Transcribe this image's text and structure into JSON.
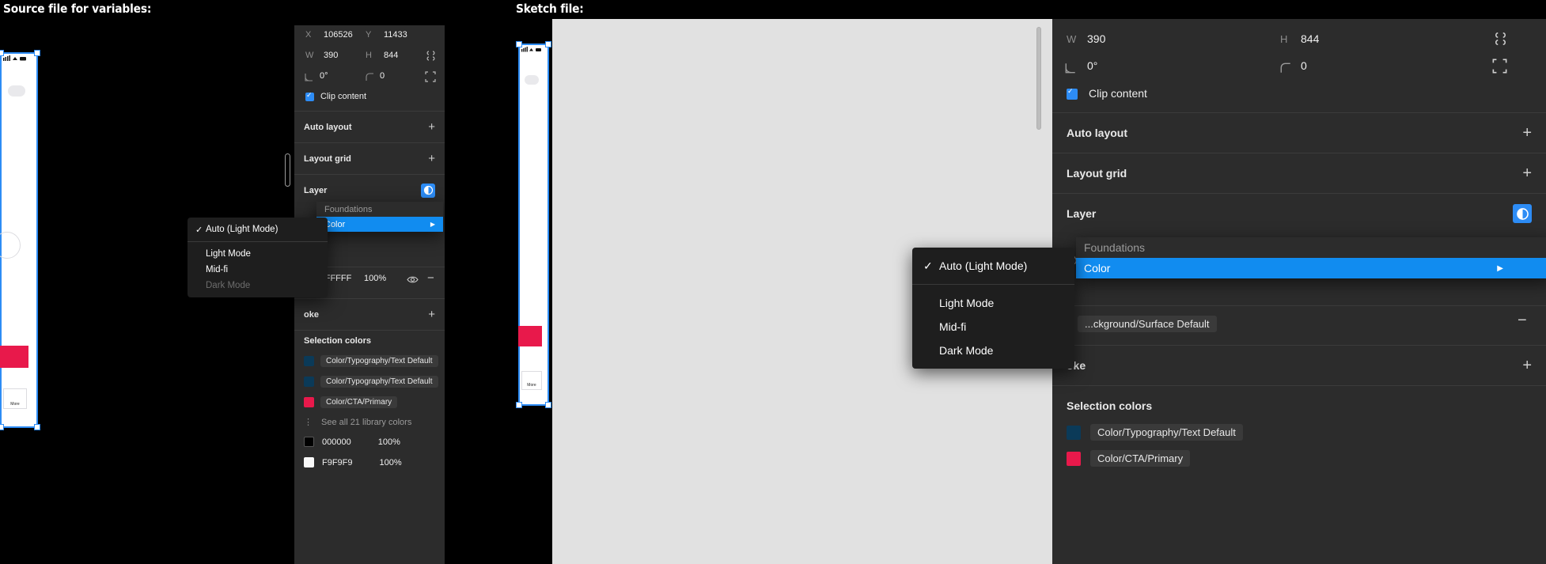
{
  "captions": {
    "left": "Source file for variables:",
    "right": "Sketch file:"
  },
  "left_panel": {
    "geometry": {
      "x_label": "X",
      "x_value": "106526",
      "y_label": "Y",
      "y_value": "11433",
      "w_label": "W",
      "w_value": "390",
      "h_label": "H",
      "h_value": "844",
      "rotation_label": "rotation-icon",
      "rotation_value": "0°",
      "corner_label": "corner-radius-icon",
      "corner_value": "0",
      "clip_content_label": "Clip content",
      "clip_content_checked": true,
      "constrain_icon": "constrain-proportions-icon",
      "independent_corners_icon": "independent-corners-icon"
    },
    "sections": [
      {
        "title": "Auto layout",
        "action": "+"
      },
      {
        "title": "Layout grid",
        "action": "+"
      }
    ],
    "layer_section": {
      "title": "Layer",
      "mode_icon": "variable-mode-icon"
    },
    "fill": {
      "hex": "FFFFFF",
      "opacity": "100%",
      "visibility_icon": "eye-icon",
      "remove_icon": "minus-icon"
    },
    "stroke": {
      "title": "oke",
      "action": "+"
    },
    "selection_colors": {
      "title": "Selection colors",
      "items": [
        {
          "swatch": "#0b3a58",
          "label": "Color/Typography/Text Default"
        },
        {
          "swatch": "#0b3a58",
          "label": "Color/Typography/Text Default"
        },
        {
          "swatch": "#e8194b",
          "label": "Color/CTA/Primary"
        }
      ],
      "see_all": "See all 21 library colors",
      "raw": [
        {
          "swatch": "#000000",
          "hex": "000000",
          "opacity": "100%"
        },
        {
          "swatch": "#f9f9f9",
          "hex": "F9F9F9",
          "opacity": "100%"
        }
      ]
    },
    "context_menu": {
      "items": [
        {
          "label": "Auto (Light Mode)",
          "checked": true,
          "disabled": false
        },
        {
          "label": "Light Mode",
          "checked": false,
          "disabled": false
        },
        {
          "label": "Mid-fi",
          "checked": false,
          "disabled": false
        },
        {
          "label": "Dark Mode",
          "checked": false,
          "disabled": true
        }
      ]
    },
    "submenu": {
      "items": [
        {
          "label": "Foundations",
          "selected": false,
          "arrow": ""
        },
        {
          "label": "Color",
          "selected": true,
          "arrow": "▶"
        }
      ]
    }
  },
  "right_panel": {
    "geometry": {
      "w_label": "W",
      "w_value": "390",
      "h_label": "H",
      "h_value": "844",
      "rotation_value": "0°",
      "corner_value": "0",
      "clip_content_label": "Clip content",
      "clip_content_checked": true
    },
    "sections": [
      {
        "title": "Auto layout",
        "action": "+"
      },
      {
        "title": "Layout grid",
        "action": "+"
      }
    ],
    "layer_section": {
      "title": "Layer",
      "mode_icon": "variable-mode-icon"
    },
    "fill": {
      "label": "...ckground/Surface Default",
      "remove_icon": "minus-icon"
    },
    "stroke": {
      "title": "oke",
      "action": "+"
    },
    "selection_colors": {
      "title": "Selection colors",
      "items": [
        {
          "swatch": "#0b3a58",
          "label": "Color/Typography/Text Default"
        },
        {
          "swatch": "#e8194b",
          "label": "Color/CTA/Primary"
        }
      ]
    },
    "context_menu": {
      "items": [
        {
          "label": "Auto (Light Mode)",
          "checked": true,
          "disabled": false
        },
        {
          "label": "Light Mode",
          "checked": false,
          "disabled": false
        },
        {
          "label": "Mid-fi",
          "checked": false,
          "disabled": false
        },
        {
          "label": "Dark Mode",
          "checked": false,
          "disabled": false
        }
      ]
    },
    "submenu": {
      "items": [
        {
          "label": "Foundations",
          "selected": false,
          "arrow": ""
        },
        {
          "label": "Color",
          "selected": true,
          "arrow": "▶"
        }
      ]
    }
  },
  "artboards": {
    "left_more_label": "More",
    "right_more_label": "More"
  },
  "colors": {
    "accent": "#2d8cf5",
    "menu_highlight": "#118cf0",
    "cta_red": "#e8194b",
    "panel_bg": "#2c2c2c",
    "menu_bg": "#1e1e1e",
    "canvas_grey": "#e1e1e1"
  }
}
